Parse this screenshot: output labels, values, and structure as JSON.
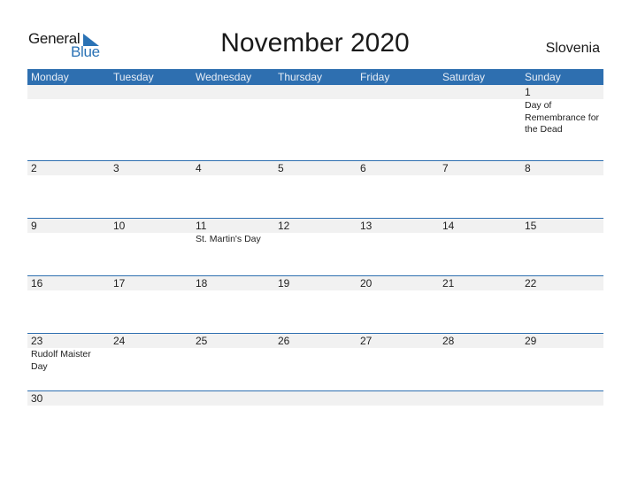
{
  "logo": {
    "general": "General",
    "blue": "Blue"
  },
  "title": "November 2020",
  "country": "Slovenia",
  "weekdays": [
    "Monday",
    "Tuesday",
    "Wednesday",
    "Thursday",
    "Friday",
    "Saturday",
    "Sunday"
  ],
  "weeks": [
    {
      "days": [
        "",
        "",
        "",
        "",
        "",
        "",
        "1"
      ],
      "events": [
        "",
        "",
        "",
        "",
        "",
        "",
        "Day of Remembrance for the Dead"
      ]
    },
    {
      "days": [
        "2",
        "3",
        "4",
        "5",
        "6",
        "7",
        "8"
      ],
      "events": [
        "",
        "",
        "",
        "",
        "",
        "",
        ""
      ]
    },
    {
      "days": [
        "9",
        "10",
        "11",
        "12",
        "13",
        "14",
        "15"
      ],
      "events": [
        "",
        "",
        "St. Martin's Day",
        "",
        "",
        "",
        ""
      ]
    },
    {
      "days": [
        "16",
        "17",
        "18",
        "19",
        "20",
        "21",
        "22"
      ],
      "events": [
        "",
        "",
        "",
        "",
        "",
        "",
        ""
      ]
    },
    {
      "days": [
        "23",
        "24",
        "25",
        "26",
        "27",
        "28",
        "29"
      ],
      "events": [
        "Rudolf Maister Day",
        "",
        "",
        "",
        "",
        "",
        ""
      ]
    },
    {
      "days": [
        "30",
        "",
        "",
        "",
        "",
        "",
        ""
      ],
      "events": [
        "",
        "",
        "",
        "",
        "",
        "",
        ""
      ]
    }
  ],
  "colors": {
    "accent": "#2e6fb0",
    "day_row_bg": "#f1f1f1"
  }
}
